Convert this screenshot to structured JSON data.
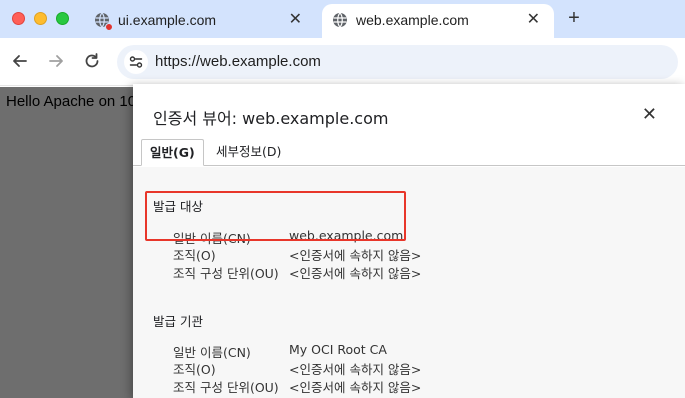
{
  "browser": {
    "tabs": [
      {
        "title": "ui.example.com",
        "active": false
      },
      {
        "title": "web.example.com",
        "active": true
      }
    ],
    "new_tab_symbol": "+",
    "close_symbol": "✕",
    "address_bar": {
      "url": "https://web.example.com"
    }
  },
  "page": {
    "text": "Hello Apache on 10"
  },
  "cert_viewer": {
    "title": "인증서 뷰어: web.example.com",
    "close_symbol": "✕",
    "tabs": [
      {
        "label": "일반(G)",
        "selected": true
      },
      {
        "label": "세부정보(D)",
        "selected": false
      }
    ],
    "issued_to": {
      "heading": "발급 대상",
      "rows": [
        {
          "label": "일반 이름(CN)",
          "value": "web.example.com"
        },
        {
          "label": "조직(O)",
          "value": "<인증서에 속하지 않음>"
        },
        {
          "label": "조직 구성 단위(OU)",
          "value": "<인증서에 속하지 않음>"
        }
      ]
    },
    "issued_by": {
      "heading": "발급 기관",
      "rows": [
        {
          "label": "일반 이름(CN)",
          "value": "My OCI Root CA"
        },
        {
          "label": "조직(O)",
          "value": "<인증서에 속하지 않음>"
        },
        {
          "label": "조직 구성 단위(OU)",
          "value": "<인증서에 속하지 않음>"
        }
      ]
    }
  },
  "colors": {
    "tabstrip": "#d3e3fd",
    "omnibox": "#edf2fa",
    "page_overlay": "#6e6e6e",
    "highlight": "#e8362a"
  },
  "icons": {
    "favicon": "globe-icon",
    "back": "arrow-left-icon",
    "forward": "arrow-right-icon",
    "reload": "reload-icon",
    "site_info": "tune-icon"
  }
}
